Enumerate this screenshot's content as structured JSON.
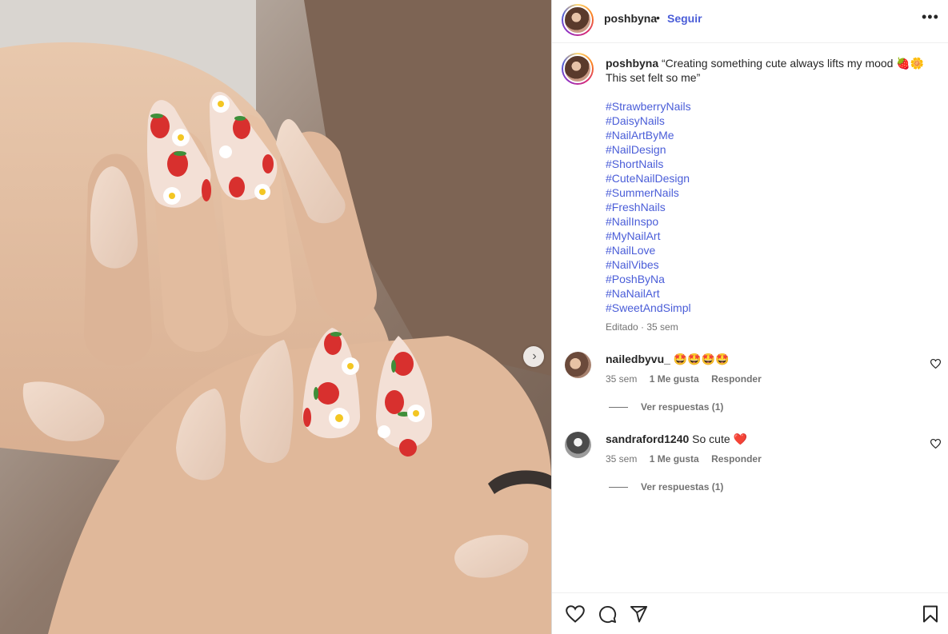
{
  "post": {
    "username": "poshbyna",
    "separator": "•",
    "follow_label": "Seguir",
    "more_icon": "more-horizontal-icon",
    "caption_user": "poshbyna",
    "caption_text": "“Creating something cute always lifts my mood 🍓🌼 This set felt so me”",
    "hashtags": [
      "#StrawberryNails",
      "#DaisyNails",
      "#NailArtByMe",
      "#NailDesign",
      "#ShortNails",
      "#CuteNailDesign",
      "#SummerNails",
      "#FreshNails",
      "#NailInspo",
      "#MyNailArt",
      "#NailLove",
      "#NailVibes",
      "#PoshByNa",
      "#NaNailArt",
      "#SweetAndSimpl"
    ],
    "edited": "Editado · 35 sem"
  },
  "comments": [
    {
      "username": "nailedbyvu_",
      "text": "🤩🤩🤩🤩",
      "time": "35 sem",
      "likes": "1 Me gusta",
      "reply_label": "Responder",
      "view_replies": "Ver respuestas (1)"
    },
    {
      "username": "sandraford1240",
      "text": "So cute ❤️",
      "time": "35 sem",
      "likes": "1 Me gusta",
      "reply_label": "Responder",
      "view_replies": "Ver respuestas (1)"
    }
  ],
  "actions": {
    "like_icon": "heart-icon",
    "comment_icon": "comment-icon",
    "share_icon": "send-icon",
    "save_icon": "bookmark-icon"
  },
  "colors": {
    "link_blue": "#4a5dd8",
    "text": "#262626",
    "muted": "#737373",
    "nail_base": "#e9d2c1",
    "strawberry": "#d8302e"
  }
}
